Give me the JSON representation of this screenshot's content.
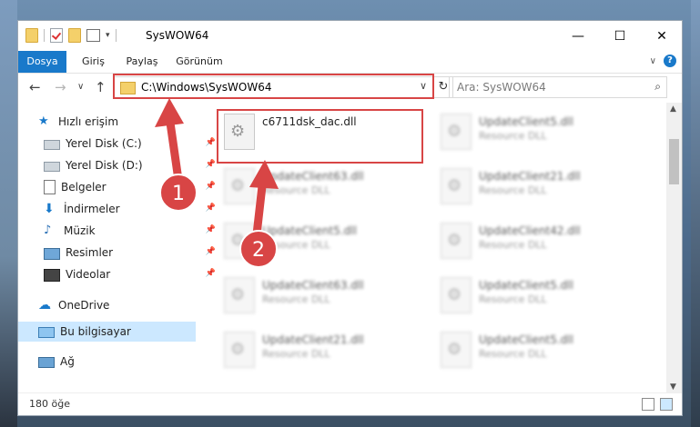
{
  "window": {
    "title": "SysWOW64"
  },
  "ribbon": {
    "tabs": [
      "Dosya",
      "Giriş",
      "Paylaş",
      "Görünüm"
    ]
  },
  "address": {
    "path": "C:\\Windows\\SysWOW64",
    "search_placeholder": "Ara: SysWOW64"
  },
  "sidebar": {
    "items": [
      {
        "label": "Hızlı erişim",
        "icon": "star-icon"
      },
      {
        "label": "Yerel Disk (C:)",
        "icon": "drive-icon"
      },
      {
        "label": "Yerel Disk (D:)",
        "icon": "drive-icon"
      },
      {
        "label": "Belgeler",
        "icon": "documents-icon"
      },
      {
        "label": "İndirmeler",
        "icon": "downloads-icon"
      },
      {
        "label": "Müzik",
        "icon": "music-icon"
      },
      {
        "label": "Resimler",
        "icon": "pictures-icon"
      },
      {
        "label": "Videolar",
        "icon": "videos-icon"
      },
      {
        "label": "OneDrive",
        "icon": "cloud-icon"
      },
      {
        "label": "Bu bilgisayar",
        "icon": "computer-icon"
      },
      {
        "label": "Ağ",
        "icon": "network-icon"
      }
    ]
  },
  "files": [
    {
      "name": "c6711dsk_dac.dll",
      "type": ""
    },
    {
      "name": "UpdateClient5.dll",
      "type": "Resource DLL"
    },
    {
      "name": "UpdateClient63.dll",
      "type": "Resource DLL"
    },
    {
      "name": "UpdateClient21.dll",
      "type": "Resource DLL"
    },
    {
      "name": "UpdateClient5.dll",
      "type": "Resource DLL"
    },
    {
      "name": "UpdateClient42.dll",
      "type": "Resource DLL"
    },
    {
      "name": "UpdateClient63.dll",
      "type": "Resource DLL"
    },
    {
      "name": "UpdateClient5.dll",
      "type": "Resource DLL"
    },
    {
      "name": "UpdateClient21.dll",
      "type": "Resource DLL"
    },
    {
      "name": "UpdateClient5.dll",
      "type": "Resource DLL"
    }
  ],
  "status": {
    "count": "180 öğe"
  },
  "annotations": {
    "step1": "1",
    "step2": "2"
  },
  "colors": {
    "accent": "#1979ca",
    "highlight": "#d84545"
  }
}
